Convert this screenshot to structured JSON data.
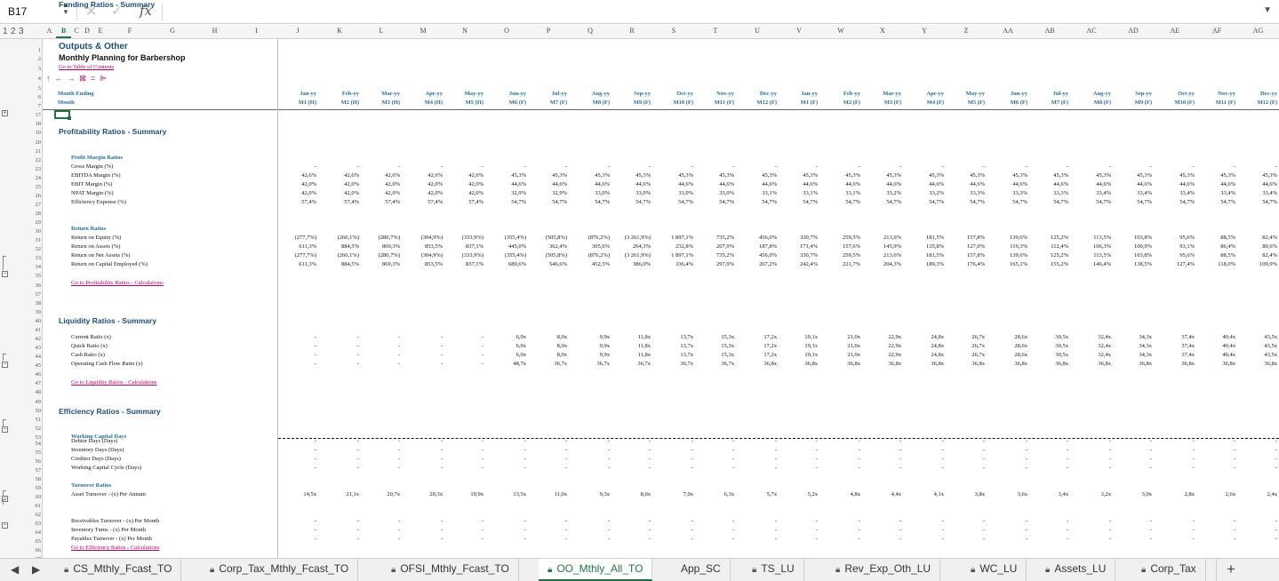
{
  "formula_bar": {
    "cell_ref": "B17",
    "cancel_icon": "✕",
    "confirm_icon": "✓",
    "fx": "fx",
    "value": ""
  },
  "outline_levels": [
    "1",
    "2",
    "3"
  ],
  "columns": [
    "A",
    "B",
    "C",
    "D",
    "E",
    "F",
    "G",
    "H",
    "I",
    "J",
    "K",
    "L",
    "M",
    "N",
    "O",
    "P",
    "Q",
    "R",
    "S",
    "T",
    "U",
    "V",
    "W",
    "X",
    "Y",
    "Z",
    "AA",
    "AB",
    "AC",
    "AD",
    "AE",
    "AF",
    "AG"
  ],
  "selected_column": "B",
  "sheet": {
    "title": "Outputs & Other",
    "subtitle": "Monthly Planning for Barbershop",
    "toc_link": "Go to Table of Contents",
    "toolbar_icons": [
      "↑",
      "←",
      "→",
      "⊠",
      "=",
      "⊫"
    ],
    "month_ending_label": "Month Ending",
    "month_label": "Month",
    "months": [
      "Jan-yy",
      "Feb-yy",
      "Mar-yy",
      "Apr-yy",
      "May-yy",
      "Jun-yy",
      "Jul-yy",
      "Aug-yy",
      "Sep-yy",
      "Oct-yy",
      "Nov-yy",
      "Dec-yy",
      "Jan-yy",
      "Feb-yy",
      "Mar-yy",
      "Apr-yy",
      "May-yy",
      "Jun-yy",
      "Jul-yy",
      "Aug-yy",
      "Sep-yy",
      "Oct-yy",
      "Nov-yy",
      "Dec-yy"
    ],
    "periods": [
      "M1 (H)",
      "M2 (H)",
      "M3 (H)",
      "M4 (H)",
      "M5 (H)",
      "M6 (F)",
      "M7 (F)",
      "M8 (F)",
      "M9 (F)",
      "M10 (F)",
      "M11 (F)",
      "M12 (F)",
      "M1 (F)",
      "M2 (F)",
      "M3 (F)",
      "M4 (F)",
      "M5 (F)",
      "M6 (F)",
      "M7 (F)",
      "M8 (F)",
      "M9 (F)",
      "M10 (F)",
      "M11 (F)",
      "M12 (F)"
    ]
  },
  "row_numbers": [
    "1",
    "2",
    "3",
    "4",
    "5",
    "6",
    "7",
    "17",
    "18",
    "19",
    "20",
    "21",
    "22",
    "23",
    "24",
    "25",
    "26",
    "27",
    "28",
    "29",
    "30",
    "31",
    "32",
    "33",
    "34",
    "35",
    "36",
    "37",
    "38",
    "39",
    "40",
    "41",
    "42",
    "43",
    "44",
    "45",
    "46",
    "47",
    "48",
    "49",
    "50",
    "51",
    "52",
    "53",
    "54",
    "55",
    "56",
    "57",
    "58",
    "59",
    "60",
    "61",
    "62",
    "63",
    "64",
    "65",
    "66",
    "67"
  ],
  "rows": [
    {
      "type": "section",
      "text": "Profitability Ratios - Summary"
    },
    {
      "type": "group",
      "text": "Profit Margin Ratios"
    },
    {
      "type": "data",
      "label": "Gross Margin (%)",
      "values": [
        "-",
        "-",
        "-",
        "-",
        "-",
        "-",
        "-",
        "-",
        "-",
        "-",
        "-",
        "-",
        "-",
        "-",
        "-",
        "-",
        "-",
        "-",
        "-",
        "-",
        "-",
        "-",
        "-",
        "-"
      ]
    },
    {
      "type": "data",
      "label": "EBITDA Margin (%)",
      "values": [
        "42,6%",
        "42,6%",
        "42,6%",
        "42,6%",
        "42,6%",
        "45,3%",
        "45,3%",
        "45,3%",
        "45,3%",
        "45,3%",
        "45,3%",
        "45,3%",
        "45,3%",
        "45,3%",
        "45,3%",
        "45,3%",
        "45,3%",
        "45,3%",
        "45,3%",
        "45,3%",
        "45,3%",
        "45,3%",
        "45,3%",
        "45,3%"
      ]
    },
    {
      "type": "data",
      "label": "EBIT Margin (%)",
      "values": [
        "42,0%",
        "42,0%",
        "42,0%",
        "42,0%",
        "42,0%",
        "44,6%",
        "44,6%",
        "44,6%",
        "44,6%",
        "44,6%",
        "44,6%",
        "44,6%",
        "44,6%",
        "44,6%",
        "44,6%",
        "44,6%",
        "44,6%",
        "44,6%",
        "44,6%",
        "44,6%",
        "44,6%",
        "44,6%",
        "44,6%",
        "44,6%"
      ]
    },
    {
      "type": "data",
      "label": "NPAT Margin (%)",
      "values": [
        "42,0%",
        "42,0%",
        "42,0%",
        "42,0%",
        "42,0%",
        "32,9%",
        "32,9%",
        "33,0%",
        "33,0%",
        "33,0%",
        "33,0%",
        "33,1%",
        "33,1%",
        "33,1%",
        "33,2%",
        "33,2%",
        "33,3%",
        "33,3%",
        "33,3%",
        "33,4%",
        "33,4%",
        "33,4%",
        "33,4%",
        "33,4%"
      ]
    },
    {
      "type": "data",
      "label": "Efficiency Expense (%)",
      "values": [
        "57,4%",
        "57,4%",
        "57,4%",
        "57,4%",
        "57,4%",
        "54,7%",
        "54,7%",
        "54,7%",
        "54,7%",
        "54,7%",
        "54,7%",
        "54,7%",
        "54,7%",
        "54,7%",
        "54,7%",
        "54,7%",
        "54,7%",
        "54,7%",
        "54,7%",
        "54,7%",
        "54,7%",
        "54,7%",
        "54,7%",
        "54,7%"
      ]
    },
    {
      "type": "group",
      "text": "Return Ratios"
    },
    {
      "type": "data",
      "label": "Return on Equity (%)",
      "values": [
        "(277,7%)",
        "(260,1%)",
        "(280,7%)",
        "(304,9%)",
        "(333,9%)",
        "(355,4%)",
        "(505,8%)",
        "(876,2%)",
        "(3 261,9%)",
        "1 897,1%",
        "735,2%",
        "456,0%",
        "330,7%",
        "259,5%",
        "213,6%",
        "181,5%",
        "157,8%",
        "139,6%",
        "125,2%",
        "113,5%",
        "103,8%",
        "95,6%",
        "88,5%",
        "82,4%"
      ]
    },
    {
      "type": "data",
      "label": "Return on Assets (%)",
      "values": [
        "611,3%",
        "884,5%",
        "869,3%",
        "853,5%",
        "837,1%",
        "445,0%",
        "362,4%",
        "305,6%",
        "264,3%",
        "232,8%",
        "207,9%",
        "187,8%",
        "171,4%",
        "157,6%",
        "145,9%",
        "135,8%",
        "127,0%",
        "119,3%",
        "112,4%",
        "106,3%",
        "100,9%",
        "93,1%",
        "86,4%",
        "80,6%"
      ]
    },
    {
      "type": "data",
      "label": "Return on Net Assets (%)",
      "values": [
        "(277,7%)",
        "(260,1%)",
        "(280,7%)",
        "(304,9%)",
        "(333,9%)",
        "(355,4%)",
        "(505,8%)",
        "(876,2%)",
        "(3 261,9%)",
        "1 897,1%",
        "735,2%",
        "456,0%",
        "330,7%",
        "259,5%",
        "213,6%",
        "181,5%",
        "157,8%",
        "139,6%",
        "125,2%",
        "113,5%",
        "103,8%",
        "95,6%",
        "88,5%",
        "82,4%"
      ]
    },
    {
      "type": "data",
      "label": "Return on Capital Employed  (%)",
      "values": [
        "611,3%",
        "884,5%",
        "869,3%",
        "853,5%",
        "837,1%",
        "689,6%",
        "546,6%",
        "452,5%",
        "386,0%",
        "336,4%",
        "297,9%",
        "267,2%",
        "242,4%",
        "221,7%",
        "204,3%",
        "189,3%",
        "176,4%",
        "165,1%",
        "155,2%",
        "146,4%",
        "138,5%",
        "127,4%",
        "118,0%",
        "109,9%"
      ]
    },
    {
      "type": "link",
      "text": "Go to Profitability Ratios - Calculations"
    },
    {
      "type": "section",
      "text": "Liquidity Ratios - Summary"
    },
    {
      "type": "data",
      "label": "Current Ratio (x)",
      "values": [
        "-",
        "-",
        "-",
        "-",
        "-",
        "6,0x",
        "8,0x",
        "9,9x",
        "11,8x",
        "13,7x",
        "15,3x",
        "17,2x",
        "19,1x",
        "21,0x",
        "22,9x",
        "24,8x",
        "26,7x",
        "28,6x",
        "30,5x",
        "32,4x",
        "34,3x",
        "37,4x",
        "40,4x",
        "43,5x"
      ]
    },
    {
      "type": "data",
      "label": "Quick Ratio (x)",
      "values": [
        "-",
        "-",
        "-",
        "-",
        "-",
        "6,0x",
        "8,0x",
        "9,9x",
        "11,8x",
        "13,7x",
        "15,3x",
        "17,2x",
        "19,1x",
        "21,0x",
        "22,9x",
        "24,8x",
        "26,7x",
        "28,6x",
        "30,5x",
        "32,4x",
        "34,3x",
        "37,4x",
        "40,4x",
        "43,5x"
      ]
    },
    {
      "type": "data",
      "label": "Cash Ratio (x)",
      "values": [
        "-",
        "-",
        "-",
        "-",
        "-",
        "6,0x",
        "8,0x",
        "9,9x",
        "11,8x",
        "13,7x",
        "15,3x",
        "17,2x",
        "19,1x",
        "21,0x",
        "22,9x",
        "24,8x",
        "26,7x",
        "28,6x",
        "30,5x",
        "32,4x",
        "34,3x",
        "37,4x",
        "40,4x",
        "43,5x"
      ]
    },
    {
      "type": "data",
      "label": "Operating Cash Flow Ratio (x)",
      "values": [
        "-",
        "-",
        "-",
        "-",
        "-",
        "48,7x",
        "36,7x",
        "36,7x",
        "36,7x",
        "36,7x",
        "36,7x",
        "36,8x",
        "36,8x",
        "36,8x",
        "36,8x",
        "36,8x",
        "36,8x",
        "36,8x",
        "36,8x",
        "36,8x",
        "36,8x",
        "36,8x",
        "36,8x",
        "36,8x"
      ]
    },
    {
      "type": "link",
      "text": "Go to Liquidity Ratios - Calculations"
    },
    {
      "type": "section",
      "text": "Efficiency Ratios - Summary"
    },
    {
      "type": "group",
      "text": "Working Capital Days"
    },
    {
      "type": "data",
      "label": "Debtor Days (Days)",
      "values": [
        "-",
        "-",
        "-",
        "-",
        "-",
        "-",
        "-",
        "-",
        "-",
        "-",
        "-",
        "-",
        "-",
        "-",
        "-",
        "-",
        "-",
        "-",
        "-",
        "-",
        "-",
        "-",
        "-",
        "-"
      ]
    },
    {
      "type": "data",
      "label": "Inventory Days (Days)",
      "values": [
        "-",
        "-",
        "-",
        "-",
        "-",
        "-",
        "-",
        "-",
        "-",
        "-",
        "-",
        "-",
        "-",
        "-",
        "-",
        "-",
        "-",
        "-",
        "-",
        "-",
        "-",
        "-",
        "-",
        "-"
      ]
    },
    {
      "type": "data",
      "label": "Creditor Days (Days)",
      "values": [
        "-",
        "-",
        "-",
        "-",
        "-",
        "-",
        "-",
        "-",
        "-",
        "-",
        "-",
        "-",
        "-",
        "-",
        "-",
        "-",
        "-",
        "-",
        "-",
        "-",
        "-",
        "-",
        "-",
        "-"
      ]
    },
    {
      "type": "data",
      "label": "Working Capital Cycle (Days)",
      "values": [
        "-",
        "-",
        "-",
        "-",
        "-",
        "-",
        "-",
        "-",
        "-",
        "-",
        "-",
        "-",
        "-",
        "-",
        "-",
        "-",
        "-",
        "-",
        "-",
        "-",
        "-",
        "-",
        "-",
        "-"
      ]
    },
    {
      "type": "group",
      "text": "Turnover Ratios"
    },
    {
      "type": "data",
      "label": "Asset Turnover - (x) Per Annum",
      "values": [
        "14,5x",
        "21,1x",
        "20,7x",
        "20,3x",
        "19,9x",
        "13,5x",
        "11,0x",
        "9,3x",
        "8,0x",
        "7,0x",
        "6,3x",
        "5,7x",
        "5,2x",
        "4,8x",
        "4,4x",
        "4,1x",
        "3,8x",
        "3,6x",
        "3,4x",
        "3,2x",
        "3,0x",
        "2,8x",
        "2,6x",
        "2,4x"
      ]
    },
    {
      "type": "data",
      "label": "Receivables Turnover - (x) Per Month",
      "values": [
        "-",
        "-",
        "-",
        "-",
        "-",
        "-",
        "-",
        "-",
        "-",
        "-",
        "-",
        "-",
        "-",
        "-",
        "-",
        "-",
        "-",
        "-",
        "-",
        "-",
        "-",
        "-",
        "-",
        "-"
      ]
    },
    {
      "type": "data",
      "label": "Inventory Turns - (x) Per Month",
      "values": [
        "-",
        "-",
        "-",
        "-",
        "-",
        "-",
        "-",
        "-",
        "-",
        "-",
        "-",
        "-",
        "-",
        "-",
        "-",
        "-",
        "-",
        "-",
        "-",
        "-",
        "-",
        "-",
        "-",
        "-"
      ]
    },
    {
      "type": "data",
      "label": "Payables Turnover - (x) Per Month",
      "values": [
        "-",
        "-",
        "-",
        "-",
        "-",
        "-",
        "-",
        "-",
        "-",
        "-",
        "-",
        "-",
        "-",
        "-",
        "-",
        "-",
        "-",
        "-",
        "-",
        "-",
        "-",
        "-",
        "-",
        "-"
      ]
    },
    {
      "type": "link",
      "text": "Go to Efficiency Ratios - Calculations"
    },
    {
      "type": "section",
      "text": "Funding Ratios - Summary"
    }
  ],
  "tabs": [
    {
      "label": "CS_Mthly_Fcast_TO",
      "locked": true,
      "active": false
    },
    {
      "label": "Corp_Tax_Mthly_Fcast_TO",
      "locked": true,
      "active": false
    },
    {
      "label": "OFSI_Mthly_Fcast_TO",
      "locked": true,
      "active": false
    },
    {
      "label": "OO_Mthly_All_TO",
      "locked": true,
      "active": true
    },
    {
      "label": "App_SC",
      "locked": false,
      "active": false
    },
    {
      "label": "TS_LU",
      "locked": true,
      "active": false
    },
    {
      "label": "Rev_Exp_Oth_LU",
      "locked": true,
      "active": false
    },
    {
      "label": "WC_LU",
      "locked": true,
      "active": false
    },
    {
      "label": "Assets_LU",
      "locked": true,
      "active": false
    },
    {
      "label": "Corp_Tax",
      "locked": true,
      "active": false
    }
  ],
  "tab_nav": {
    "prev": "◀",
    "next": "▶",
    "add": "+"
  },
  "colors": {
    "accent": "#217346",
    "title": "#1f4e79",
    "link": "#c00060",
    "header": "#1f6e98"
  }
}
